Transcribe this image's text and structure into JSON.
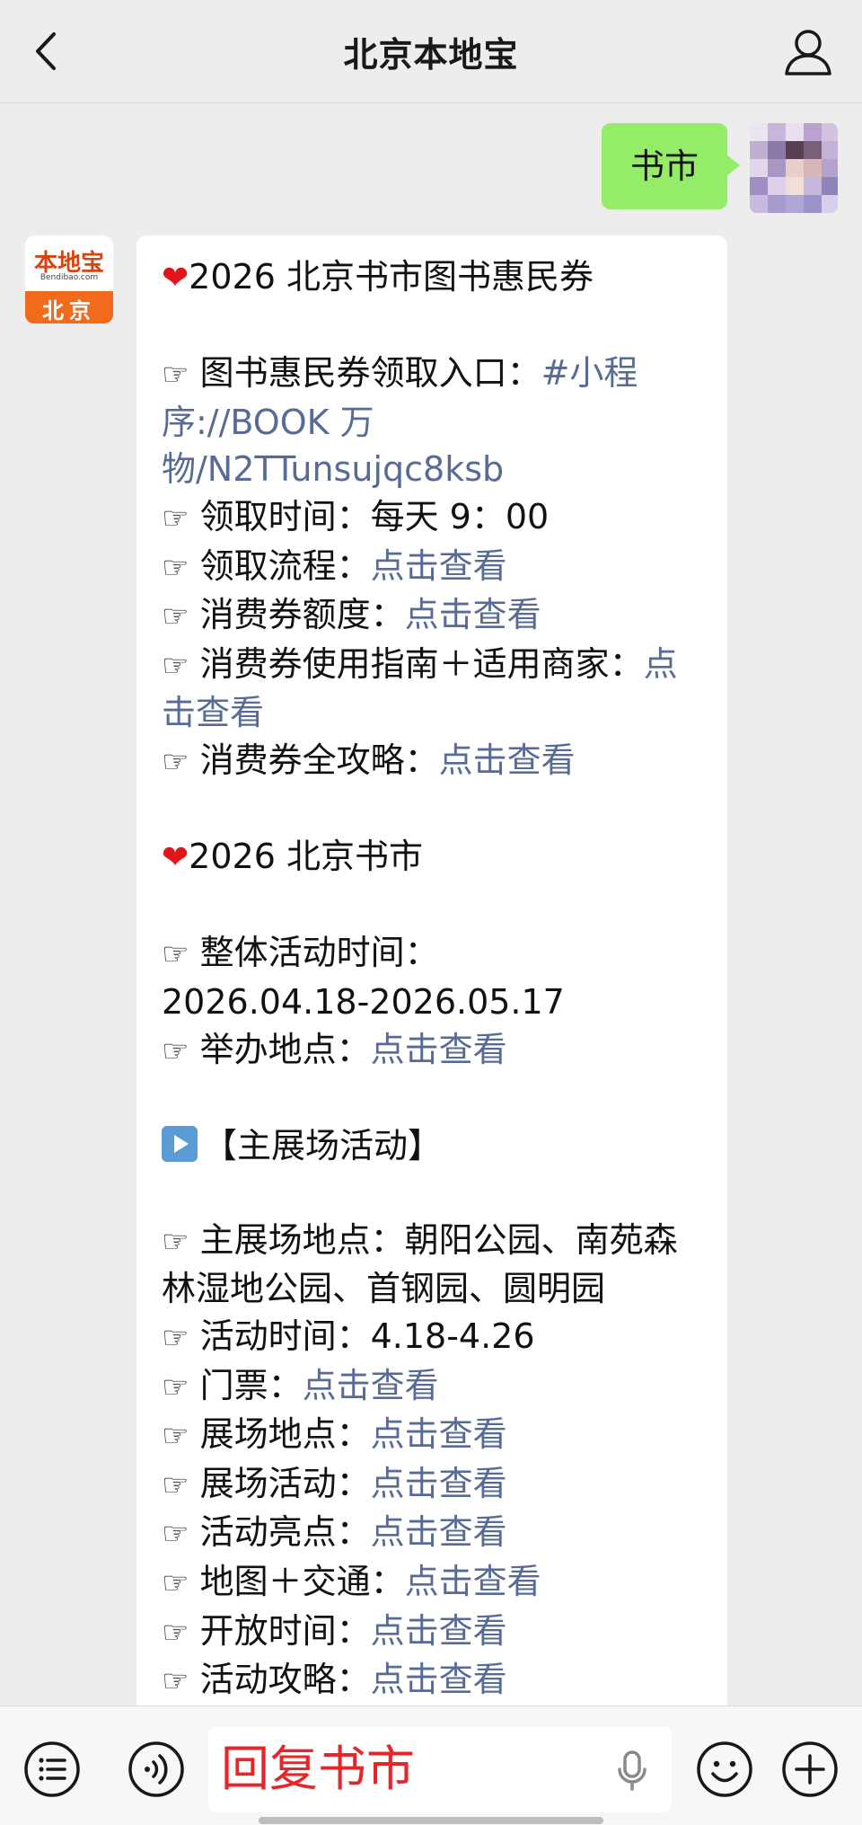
{
  "header": {
    "title": "北京本地宝",
    "back_icon": "chevron-left-icon",
    "profile_icon": "person-icon"
  },
  "user_message": {
    "text": "书市",
    "bubble_color": "#95ec69"
  },
  "bot": {
    "avatar_logo": "本地宝",
    "avatar_sub": "Bendibao.com",
    "avatar_city": "北京",
    "brand_color": "#f26a1b",
    "link_color": "#576b95",
    "section1": {
      "heading": "2026 北京书市图书惠民券",
      "entry_label": "图书惠民券领取入口：",
      "entry_link": "#小程序://BOOK 万物/N2TTunsujqc8ksb",
      "time_label": "领取时间：每天 9：00",
      "flow_label": "领取流程：",
      "quota_label": "消费券额度：",
      "guide_label": "消费券使用指南＋适用商家：",
      "strategy_label": "消费券全攻略："
    },
    "section2": {
      "heading": "2026 北京书市",
      "period_label": "整体活动时间：",
      "period_value": "2026.04.18-2026.05.17",
      "venue_label": "举办地点："
    },
    "section3": {
      "heading": "【主展场活动】",
      "places_label": "主展场地点：朝阳公园、南苑森林湿地公园、首钢园、圆明园",
      "time_label": "活动时间：4.18-4.26",
      "ticket_label": "门票：",
      "site_label": "展场地点：",
      "events_label": "展场活动：",
      "highlights_label": "活动亮点：",
      "map_label": "地图＋交通：",
      "hours_label": "开放时间：",
      "guide_label": "活动攻略："
    },
    "view_link": "点击查看"
  },
  "input_bar": {
    "text": "回复书市",
    "text_color": "#e8262a",
    "menu_icon": "list-menu-icon",
    "voice_icon": "voice-icon",
    "mic_icon": "mic-icon",
    "emoji_icon": "emoji-icon",
    "plus_icon": "plus-icon"
  }
}
